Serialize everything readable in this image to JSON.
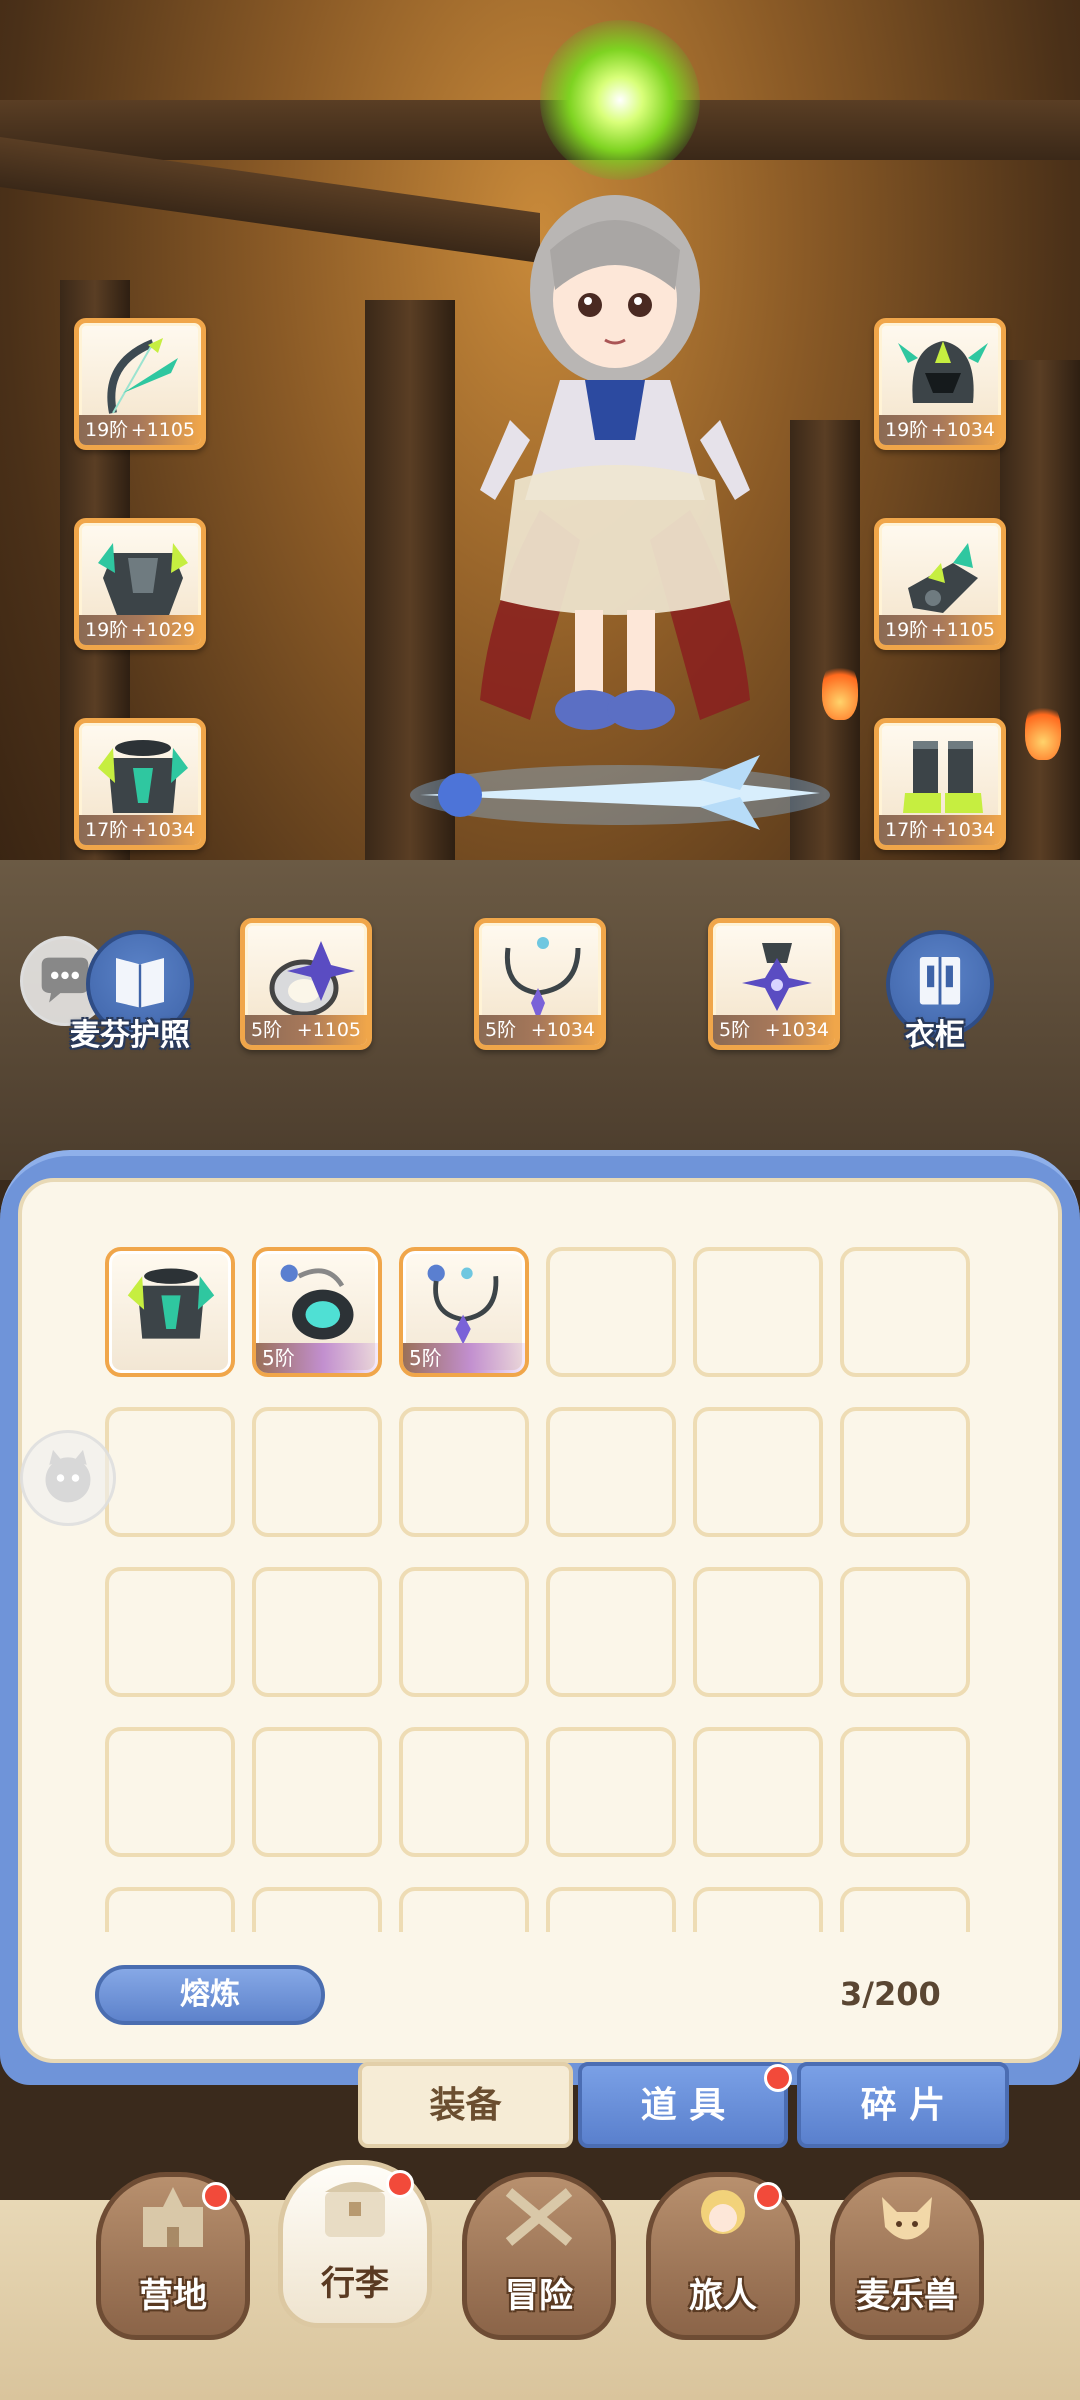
{
  "equipped": {
    "left": [
      {
        "tier": "19阶",
        "power": "+1105",
        "icon": "bow-icon"
      },
      {
        "tier": "19阶",
        "power": "+1029",
        "icon": "armor-icon"
      },
      {
        "tier": "17阶",
        "power": "+1034",
        "icon": "armor-icon"
      }
    ],
    "right": [
      {
        "tier": "19阶",
        "power": "+1034",
        "icon": "helmet-icon"
      },
      {
        "tier": "19阶",
        "power": "+1105",
        "icon": "gauntlet-icon"
      },
      {
        "tier": "17阶",
        "power": "+1034",
        "icon": "boots-icon"
      }
    ],
    "accessories": [
      {
        "tier": "5阶",
        "power": "+1105",
        "icon": "ring-icon"
      },
      {
        "tier": "5阶",
        "power": "+1034",
        "icon": "necklace-icon"
      },
      {
        "tier": "5阶",
        "power": "+1034",
        "icon": "amulet-icon"
      }
    ]
  },
  "side_buttons": {
    "passport_label": "麦芬护照",
    "wardrobe_label": "衣柜"
  },
  "inventory": {
    "items": [
      {
        "tier": "",
        "icon": "armor-icon",
        "style": "orange"
      },
      {
        "tier": "5阶",
        "icon": "ring-icon",
        "style": "purple"
      },
      {
        "tier": "5阶",
        "icon": "necklace-icon",
        "style": "purple"
      }
    ],
    "smelt_label": "熔炼",
    "capacity": "3/200"
  },
  "tabs": {
    "equipment": "装备",
    "items": "道 具",
    "fragments": "碎 片"
  },
  "nav": {
    "camp": "营地",
    "bag": "行李",
    "adventure": "冒险",
    "travelers": "旅人",
    "pets": "麦乐兽"
  },
  "colors": {
    "accent_orange": "#f0a64a",
    "panel_blue": "#6f94d9",
    "badge_red": "#f24a3a"
  }
}
